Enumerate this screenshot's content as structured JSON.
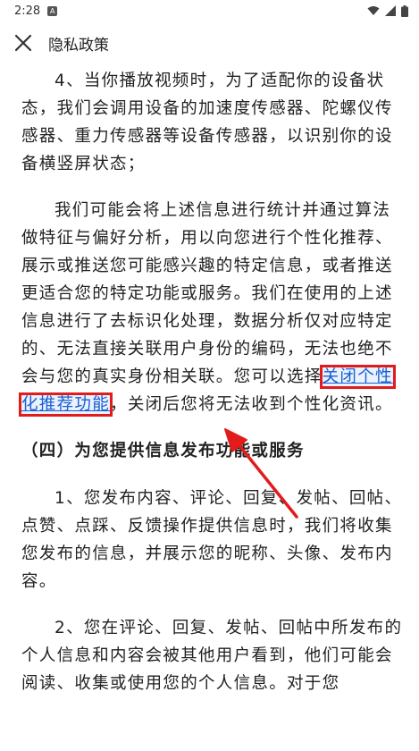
{
  "status_bar": {
    "time": "2:28",
    "notification_letter": "A"
  },
  "appbar": {
    "title": "隐私政策",
    "close_icon": "close-icon"
  },
  "content": {
    "p1": "4、当你播放视频时，为了适配你的设备状态，我们会调用设备的加速度传感器、陀螺仪传感器、重力传感器等设备传感器，以识别你的设备横竖屏状态；",
    "p2_before": "我们可能会将上述信息进行统计并通过算法做特征与偏好分析，用以向您进行个性化推荐、展示或推送您可能感兴趣的特定信息，或者推送更适合您的特定功能或服务。我们在使用的上述信息进行了去标识化处理，数据分析仅对应特定的、无法直接关联用户身份的编码，无法也绝不会与您的真实身份相关联。您可以选择",
    "p2_link": "关闭个性化推荐功能",
    "p2_after": "，关闭后您将无法收到个性化资讯。",
    "section4_title": "（四）为您提供信息发布功能或服务",
    "p3": "1、您发布内容、评论、回复、发帖、回帖、点赞、点踩、反馈操作提供信息时，我们将收集您发布的信息，并展示您的昵称、头像、发布内容。",
    "p4": "2、您在评论、回复、发帖、回帖中所发布的个人信息和内容会被其他用户看到，他们可能会阅读、收集或使用您的个人信息。对于您"
  },
  "colors": {
    "link": "#1a5fd0",
    "highlight_box": "#e21b1b",
    "arrow": "#e21b1b"
  }
}
